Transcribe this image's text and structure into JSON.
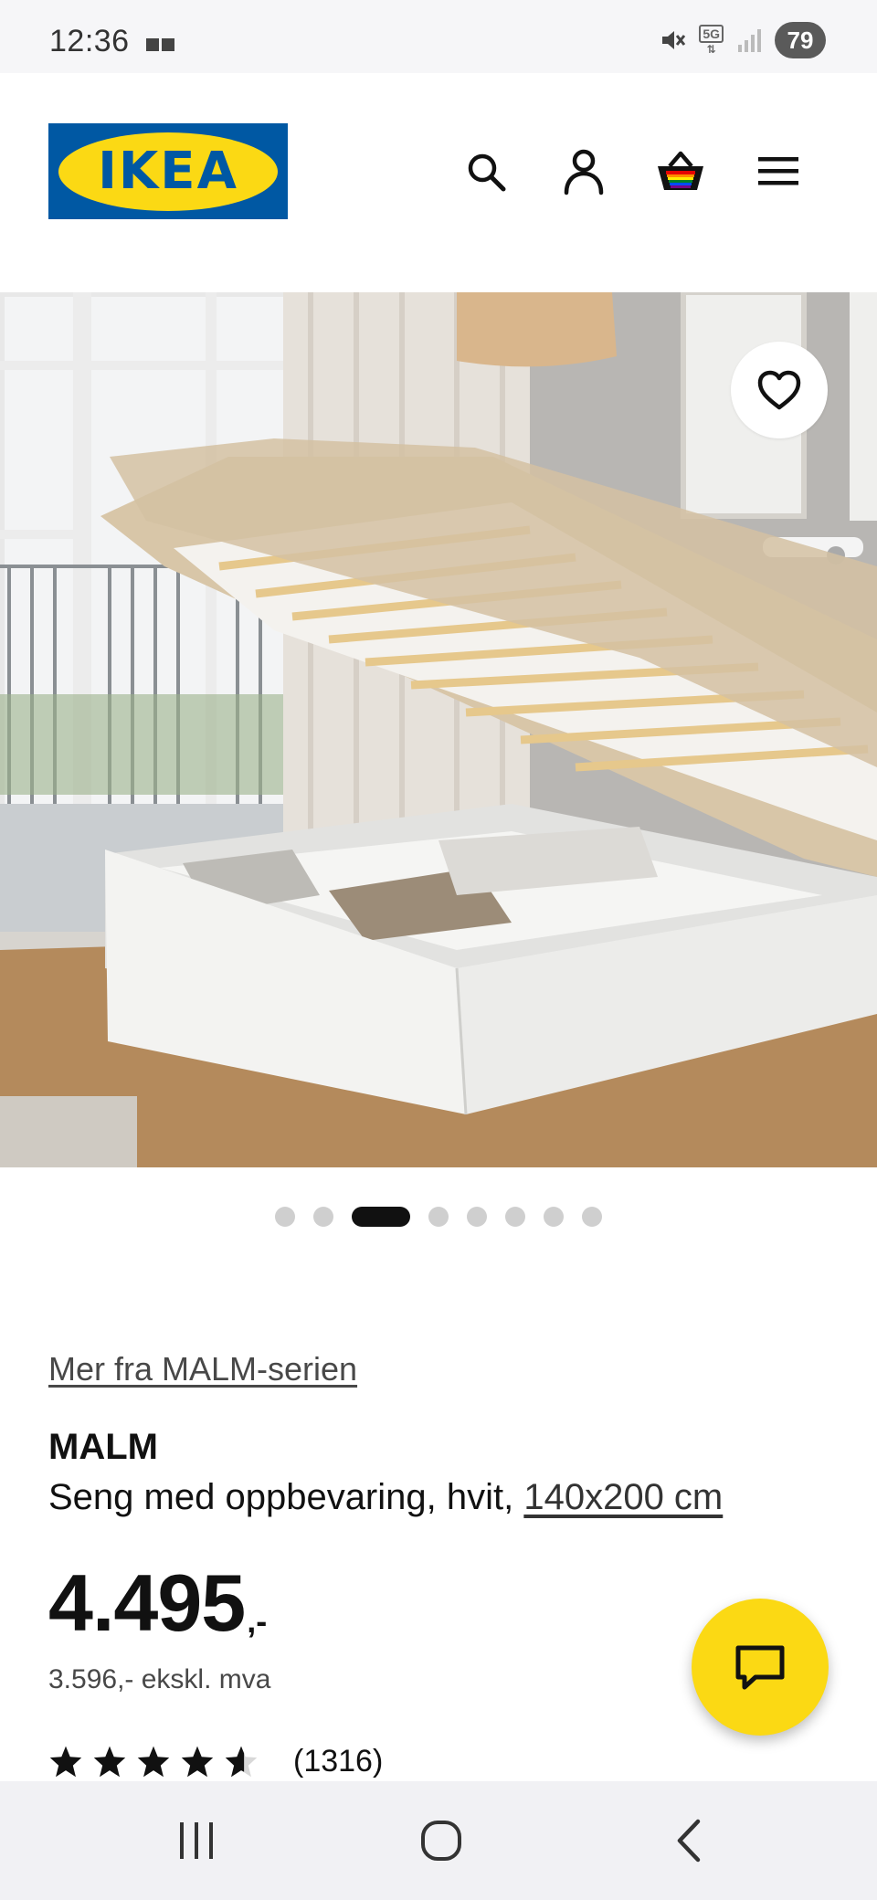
{
  "status_bar": {
    "time": "12:36",
    "network": "5G",
    "battery": "79"
  },
  "header": {
    "logo_text": "IKEA",
    "brand_blue": "#0058a3",
    "brand_yellow": "#fbd914",
    "icons": [
      "search-icon",
      "account-icon",
      "shopping-bag-icon",
      "menu-icon"
    ]
  },
  "gallery": {
    "image_description_name": "bed-storage-photo",
    "total_images": 8,
    "active_index": 2
  },
  "product": {
    "series_link": "Mer fra MALM-serien",
    "name": "MALM",
    "description": "Seng med oppbevaring, hvit,",
    "size_link": "140x200 cm",
    "price": "4.495",
    "price_suffix": ",-",
    "price_ex_vat": "3.596,- ekskl. mva",
    "rating_value": 4.6,
    "rating_count": "(1316)"
  },
  "chat": {
    "icon": "chat-icon"
  },
  "nav_bar": {
    "buttons": [
      "recent-apps-icon",
      "home-icon",
      "back-icon"
    ]
  }
}
